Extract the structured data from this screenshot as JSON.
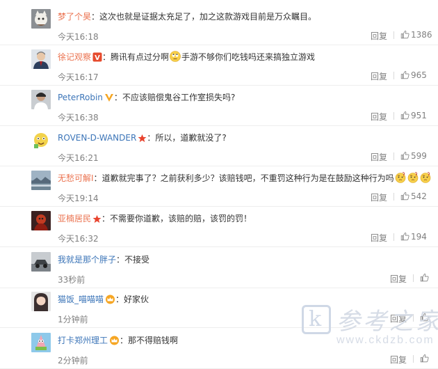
{
  "comments": [
    {
      "user": "梦了个昊",
      "badge": "",
      "text_parts": [
        "这次也就是证据太充足了，加之这款游戏目前是万众瞩目。"
      ],
      "emojis": [],
      "time": "今天16:18",
      "reply": "回复",
      "likes": "1386",
      "avatar": "cat"
    },
    {
      "user": "徐记观察",
      "badge": "v-red-icon",
      "text_parts": [
        "腾讯有点过分啊",
        "手游不够你们吃钱吗还来搞独立游戏"
      ],
      "emojis": [
        "eyes-roll-emoji"
      ],
      "time": "今天16:17",
      "reply": "回复",
      "likes": "965",
      "avatar": "man"
    },
    {
      "user": "PeterRobin",
      "badge": "v-yellow-icon",
      "text_parts": [
        "不应该赔偿鬼谷工作室损失吗?"
      ],
      "emojis": [],
      "time": "今天16:38",
      "reply": "回复",
      "likes": "951",
      "avatar": "person"
    },
    {
      "user": "ROVEN-D-WANDER",
      "badge": "star-icon",
      "text_parts": [
        "所以，道歉就没了?"
      ],
      "emojis": [],
      "time": "今天16:21",
      "reply": "回复",
      "likes": "599",
      "avatar": "cartoon"
    },
    {
      "user": "无愁可解I",
      "badge": "",
      "text_parts": [
        "道歉就完事了？之前获利多少？该赔钱吧，不重罚这种行为是在鼓励这种行为吗"
      ],
      "emojis": [
        "thinking-emoji",
        "thinking-emoji",
        "thinking-emoji"
      ],
      "time": "今天19:14",
      "reply": "回复",
      "likes": "542",
      "avatar": "landscape"
    },
    {
      "user": "亚楠居民",
      "badge": "star-icon",
      "text_parts": [
        "不需要你道歉，该赔的赔，该罚的罚！"
      ],
      "emojis": [],
      "time": "今天16:32",
      "reply": "回复",
      "likes": "194",
      "avatar": "red"
    },
    {
      "user": "我就是那个胖子",
      "badge": "",
      "text_parts": [
        "不接受"
      ],
      "emojis": [],
      "time": "33秒前",
      "reply": "回复",
      "likes": "",
      "avatar": "car"
    },
    {
      "user": "猫饭_喵喵喵",
      "badge": "crown-icon",
      "text_parts": [
        "好家伙"
      ],
      "emojis": [],
      "time": "1分钟前",
      "reply": "回复",
      "likes": "",
      "avatar": "girl"
    },
    {
      "user": "打卡郑州理工",
      "badge": "crown-icon",
      "text_parts": [
        "那不得赔钱啊"
      ],
      "emojis": [],
      "time": "2分钟前",
      "reply": "回复",
      "likes": "",
      "avatar": "patrick"
    }
  ],
  "colors": {
    "username_blue": "#3c75b8",
    "username_orange": "#eb7350",
    "meta_gray": "#808080"
  },
  "watermark": {
    "title": "参考之家",
    "url": "www.ckdzb.com",
    "logo_letter": "k"
  }
}
